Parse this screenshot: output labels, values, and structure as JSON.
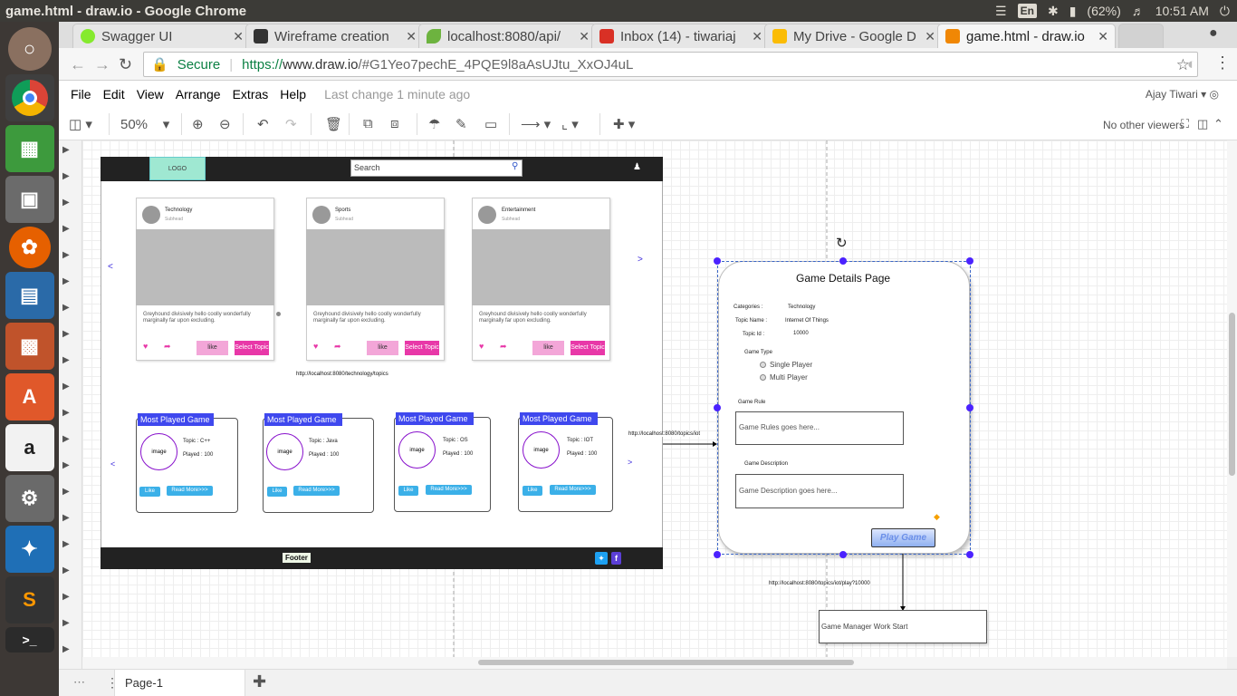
{
  "os": {
    "window_title": "game.html - draw.io - Google Chrome",
    "lang": "En",
    "battery": "(62%)",
    "time": "10:51 AM"
  },
  "tabs": [
    {
      "label": "Swagger UI",
      "color": "#85ea2d"
    },
    {
      "label": "Wireframe creation",
      "color": "#333333"
    },
    {
      "label": "localhost:8080/api/",
      "color": "#6db33f"
    },
    {
      "label": "Inbox (14) - tiwariaj",
      "color": "#d93025"
    },
    {
      "label": "My Drive - Google D",
      "color": "#fbbc04"
    },
    {
      "label": "game.html - draw.io",
      "color": "#f08705"
    }
  ],
  "address": {
    "secure": "Secure",
    "scheme": "https://",
    "host": "www.draw.io",
    "path": "/#G1Yeo7pechE_4PQE9l8aAsUJtu_XxOJ4uL"
  },
  "menu": {
    "items": [
      "File",
      "Edit",
      "View",
      "Arrange",
      "Extras",
      "Help"
    ],
    "last_change": "Last change 1 minute ago",
    "user": "Ajay Tiwari"
  },
  "toolbar": {
    "zoom": "50%",
    "viewers": "No other viewers"
  },
  "pagebar": {
    "page": "Page-1"
  },
  "diagram": {
    "logo": "LOGO",
    "search": "Search",
    "cards": [
      {
        "title": "Technology",
        "subhead": "Subhead",
        "text": "Greyhound divisively hello coolly wonderfully marginally far upon excluding.",
        "like": "like",
        "select": "Select Topic"
      },
      {
        "title": "Sports",
        "subhead": "Subhead",
        "text": "Greyhound divisively hello coolly wonderfully marginally far upon excluding.",
        "like": "like",
        "select": "Select Topic"
      },
      {
        "title": "Entertainment",
        "subhead": "Subhead",
        "text": "Greyhound divisively hello coolly wonderfully marginally far upon excluding.",
        "like": "like",
        "select": "Select Topic"
      }
    ],
    "topics_url": "http://localhost:8080/technology/topics",
    "games": [
      {
        "header": "Most Played Game",
        "image": "image",
        "topic": "Topic : C++",
        "played": "Played : 100",
        "like": "Like",
        "read": "Read More>>>"
      },
      {
        "header": "Most Played Game",
        "image": "image",
        "topic": "Topic : Java",
        "played": "Played : 100",
        "like": "Like",
        "read": "Read More>>>"
      },
      {
        "header": "Most Played Game",
        "image": "image",
        "topic": "Topic : OS",
        "played": "Played : 100",
        "like": "Like",
        "read": "Read More>>>"
      },
      {
        "header": "Most Played Game",
        "image": "image",
        "topic": "Topic : IOT",
        "played": "Played : 100",
        "like": "Like",
        "read": "Read More>>>"
      }
    ],
    "iot_url": "http://localhost:8080/topics/iot",
    "footer": "Footer",
    "prev": "<",
    "next": ">",
    "details": {
      "title": "Game Details Page",
      "cat_label": "Categories :",
      "cat_value": "Technology",
      "name_label": "Topic Name :",
      "name_value": "Internet Of Things",
      "id_label": "Topic Id :",
      "id_value": "10000",
      "type_label": "Game Type",
      "single": "Single Player",
      "multi": "Multi Player",
      "rule_label": "Game Rule",
      "rule_text": "Game Rules goes here...",
      "desc_label": "Game Description",
      "desc_text": "Game Description goes here...",
      "play": "Play Game"
    },
    "play_url": "http://localhost:8080/topics/iot/play?10000",
    "manager": "Game Manager Work Start"
  }
}
